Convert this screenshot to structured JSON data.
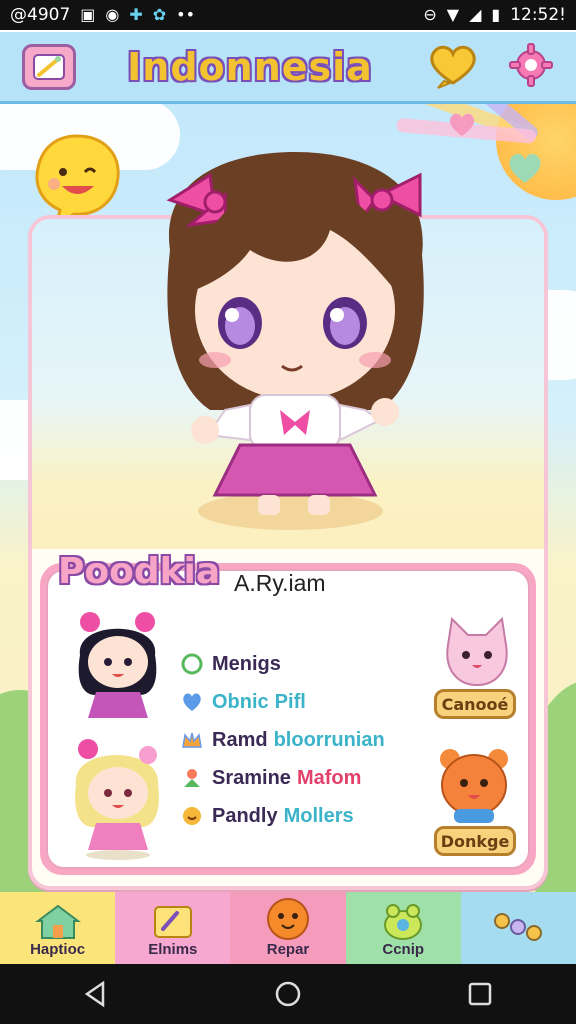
{
  "status_bar": {
    "left_text": "@4907",
    "time": "12:52!"
  },
  "app_bar": {
    "title": "Indonnesia",
    "icons": [
      "paint-brush-icon",
      "speech-heart-icon",
      "settings-gear-icon"
    ]
  },
  "profile": {
    "name_banner": "Poodkia",
    "subtitle": "A.Ry.iam",
    "stats": [
      {
        "icon": "green-heart-icon",
        "key": "Menigs",
        "value": "",
        "value_color": "#3b2a55"
      },
      {
        "icon": "blue-heart-icon",
        "key": "Obnic",
        "value": "Pifl",
        "value_color": "#3bb3c9"
      },
      {
        "icon": "crown-icon",
        "key": "Ramd",
        "value": "bloorrunian",
        "value_color": "#3bb3c9"
      },
      {
        "icon": "flower-icon",
        "key": "Sramine",
        "value": "Mafom",
        "value_color": "#e2416b"
      },
      {
        "icon": "smile-icon",
        "key": "Pandly",
        "value": "Mollers",
        "value_color": "#3bb3c9"
      }
    ],
    "buttons": {
      "cat_button": "Canooé",
      "bear_button": "Donkge"
    }
  },
  "tabs": [
    {
      "label": "Haptioc",
      "color": "#fbe57b",
      "icon": "house-icon"
    },
    {
      "label": "Elnims",
      "color": "#f7a8d1",
      "icon": "art-board-icon"
    },
    {
      "label": "Repar",
      "color": "#f59cbd",
      "icon": "orange-face-icon"
    },
    {
      "label": "Ccnip",
      "color": "#9fe0a8",
      "icon": "frog-icon"
    },
    {
      "label": "",
      "color": "#a6dcef",
      "icon": "dots-icon"
    }
  ],
  "colors": {
    "accent_pink": "#f7a6c4",
    "accent_purple": "#7a4fb8",
    "accent_yellow": "#f2c230"
  }
}
